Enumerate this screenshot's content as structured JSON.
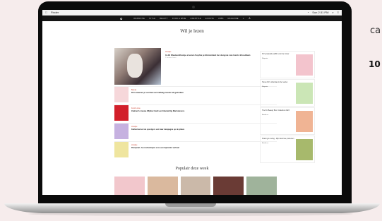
{
  "side_text": {
    "top": "ca",
    "bottom": "10"
  },
  "menubar": {
    "apple": "",
    "app": "Finder",
    "time": "Sun 2:31 PM"
  },
  "sitenav": {
    "items": [
      "INSPIRATIE",
      "STYLE",
      "BEAUTY",
      "FOOD & WINE",
      "LIFESTYLE",
      "ECOUTE",
      "JOBS",
      "MAGAZINE"
    ]
  },
  "section_title": "Wil je lezen",
  "lead": {
    "tag": "Lifestyle",
    "title": "In dit Weekendhuisje ervaren Sophie je Bretonkant de Hoogste van Gents Broodlaan",
    "meta": "2 minuten lezen"
  },
  "rows": [
    {
      "tag": "Beauty",
      "text": "Dit is waarom je voortaan een halfdag moeder wil gebruiken",
      "color": "#f6d7da"
    },
    {
      "tag": "Food & wine",
      "text": "Zaalmet's nieuwe Wijnbar biedt een fabelachtig Marinelevens",
      "color": "#d21f2a"
    },
    {
      "tag": "Lifestyle",
      "text": "Katharina bed de opvolgers van haar dampagne op de platen",
      "color": "#c6b1e0"
    },
    {
      "tag": "Lifestyle",
      "text": "Rompmat. Je voorbedrijven voor een bijzonder verhaal",
      "color": "#efe59f"
    }
  ],
  "side_cards": [
    {
      "text": "KC's populaire adfilm voor de zomer",
      "more": "Magazin",
      "color": "#f3c4cd"
    },
    {
      "text": "Tonen KC's chocola om het verzet",
      "more": "Magazin",
      "color": "#cbe6b6"
    },
    {
      "text": "The KC Beauty Box: Collection 2023",
      "more": "Bestel nu",
      "color": "#f0b494"
    },
    {
      "text": "Sharing is caring - Mijn favoriete producten",
      "more": "Bestel nu",
      "color": "#a7b96c"
    }
  ],
  "popular_title": "Populair deze week",
  "popular_colors": [
    "#f2c7cc",
    "#dab99e",
    "#cbb9a9",
    "#6a3b35",
    "#9fb39b"
  ],
  "colors": {
    "page_bg": "#f6ecec",
    "nav_bg": "#151515"
  }
}
